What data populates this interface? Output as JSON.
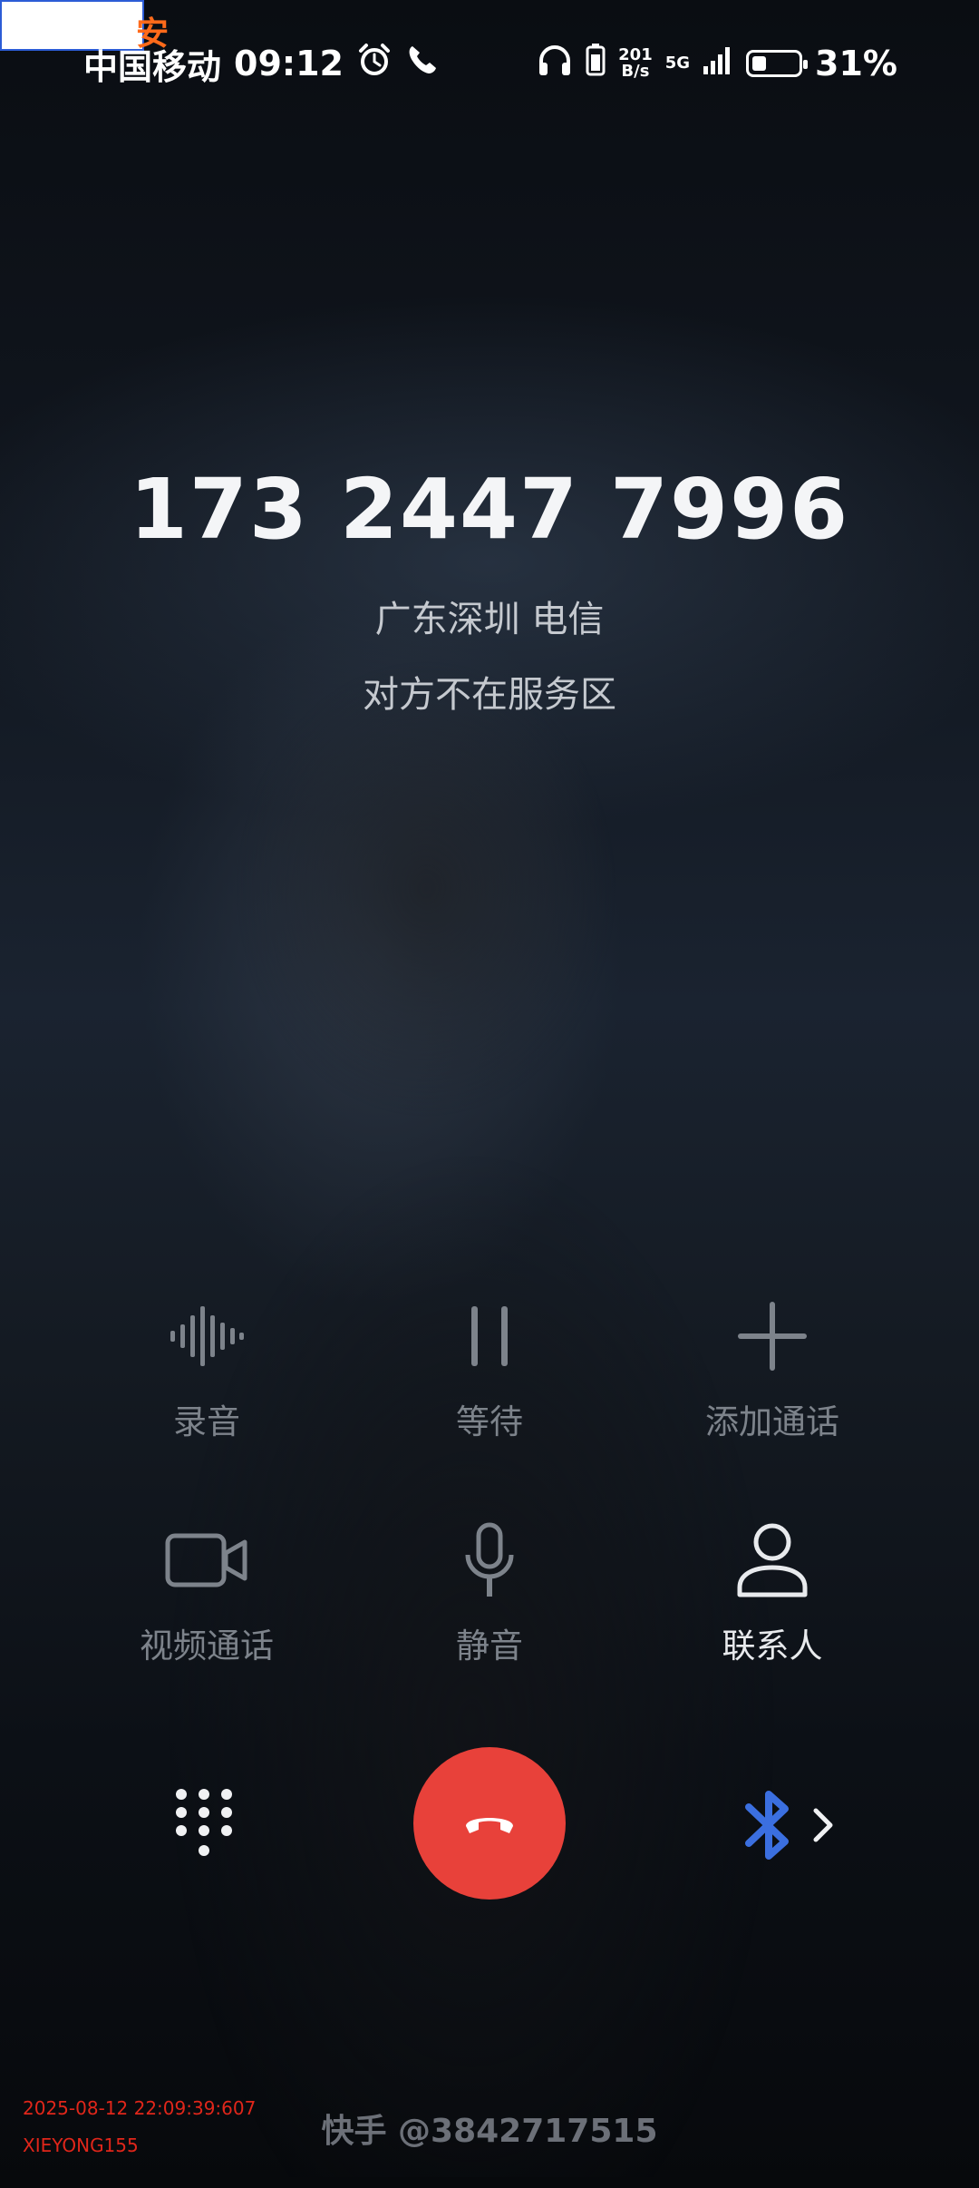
{
  "status_bar": {
    "carrier": "中国移动",
    "time": "09:12",
    "net_speed_top": "201",
    "net_speed_bottom": "B/s",
    "network_type": "5G",
    "battery_percent": "31%",
    "battery_level": 0.31
  },
  "overlay_text": "安",
  "call": {
    "number": "173 2447 7996",
    "location": "广东深圳 电信",
    "status": "对方不在服务区"
  },
  "controls": [
    {
      "label": "录音",
      "icon": "waveform-icon"
    },
    {
      "label": "等待",
      "icon": "pause-icon"
    },
    {
      "label": "添加通话",
      "icon": "plus-icon"
    },
    {
      "label": "视频通话",
      "icon": "video-camera-icon"
    },
    {
      "label": "静音",
      "icon": "microphone-icon"
    },
    {
      "label": "联系人",
      "icon": "person-icon"
    }
  ],
  "colors": {
    "end_call": "#e8413a",
    "bluetooth": "#3b6fe0",
    "disabled_text": "#7d838b",
    "stamp": "#e0261a"
  },
  "watermark": "快手 @3842717515",
  "stamp": {
    "datetime": "2025-08-12 22:09:39:607",
    "user": "XIEYONG155"
  }
}
